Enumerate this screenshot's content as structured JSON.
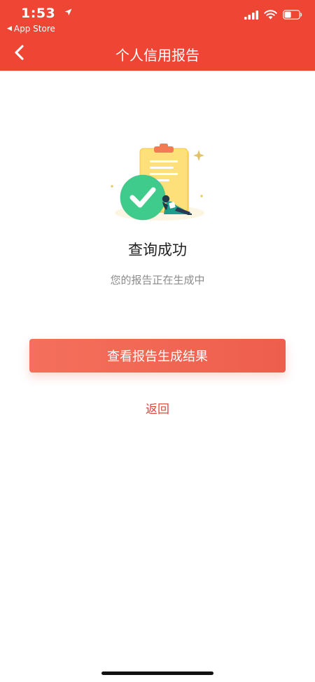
{
  "status_bar": {
    "time": "1:53",
    "back_app": "App Store"
  },
  "nav": {
    "title": "个人信用报告"
  },
  "result": {
    "title": "查询成功",
    "subtitle": "您的报告正在生成中"
  },
  "actions": {
    "primary_label": "查看报告生成结果",
    "return_label": "返回"
  },
  "colors": {
    "header": "#ee4535",
    "button": "#f06a57",
    "link": "#e0473a",
    "success": "#3ec98a"
  }
}
